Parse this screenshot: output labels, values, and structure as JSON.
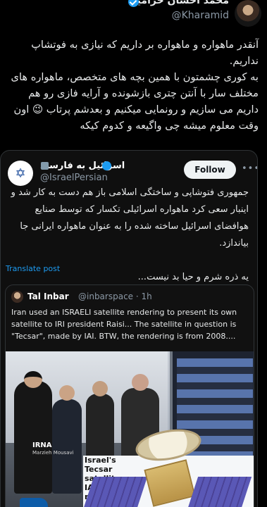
{
  "profile": {
    "name": "محمد احسان خرامید",
    "handle": "@Kharamid"
  },
  "tweet": {
    "text": "آنقدر ماهواره و ماهواره بر داریم که نیازی به فوتشاپ نداریم.\nبه کوری چشمتون با همین بچه های متخصص، ماهواره های مختلف سار با آنتن چتری بازشونده و آرایه فازی رو هم داریم می سازیم و رونمایی میکنیم و بعدشم پرتاب 😉 اون وقت معلوم میشه چی واگیعه و کدوم کیکه"
  },
  "quote": {
    "name": "اسرائیل به فارسی",
    "handle": "@IsraelPersian",
    "follow_label": "Follow",
    "more_label": "•••",
    "text": "جمهوری فتوشاپی و ساختگی اسلامی باز هم دست به کار شد و اینبار سعی کرد ماهواره اسرائیلی تکسار که توسط صنایع هوافضای اسرائیل ساخته شده را به عنوان ماهواره ایرانی جا بیاندازد.\n\nیه ذره شرم و حیا بد نیست...",
    "translate_label": "Translate post",
    "nested": {
      "name": "Tal Inbar",
      "handle": "@inbarspace · 1h",
      "text": "Iran used an ISRAELI satellite rendering to present its own satellite to IRI president Raisi... The satellite in question is \"Tecsar\", made by IAI. BTW, the rendering is from 2008....",
      "image_caption": "Israel's Tecsar satellite – IAI rendering",
      "watermark": "IRNA",
      "watermark_sub": "Marzieh Mousavi"
    }
  },
  "icons": {
    "verified": "verified-badge-icon",
    "menorah": "menorah-logo-icon",
    "more": "more-icon"
  },
  "colors": {
    "background": "#000000",
    "text": "#e7e9ea",
    "secondary": "#8b98a5",
    "link": "#1d9bf0"
  }
}
